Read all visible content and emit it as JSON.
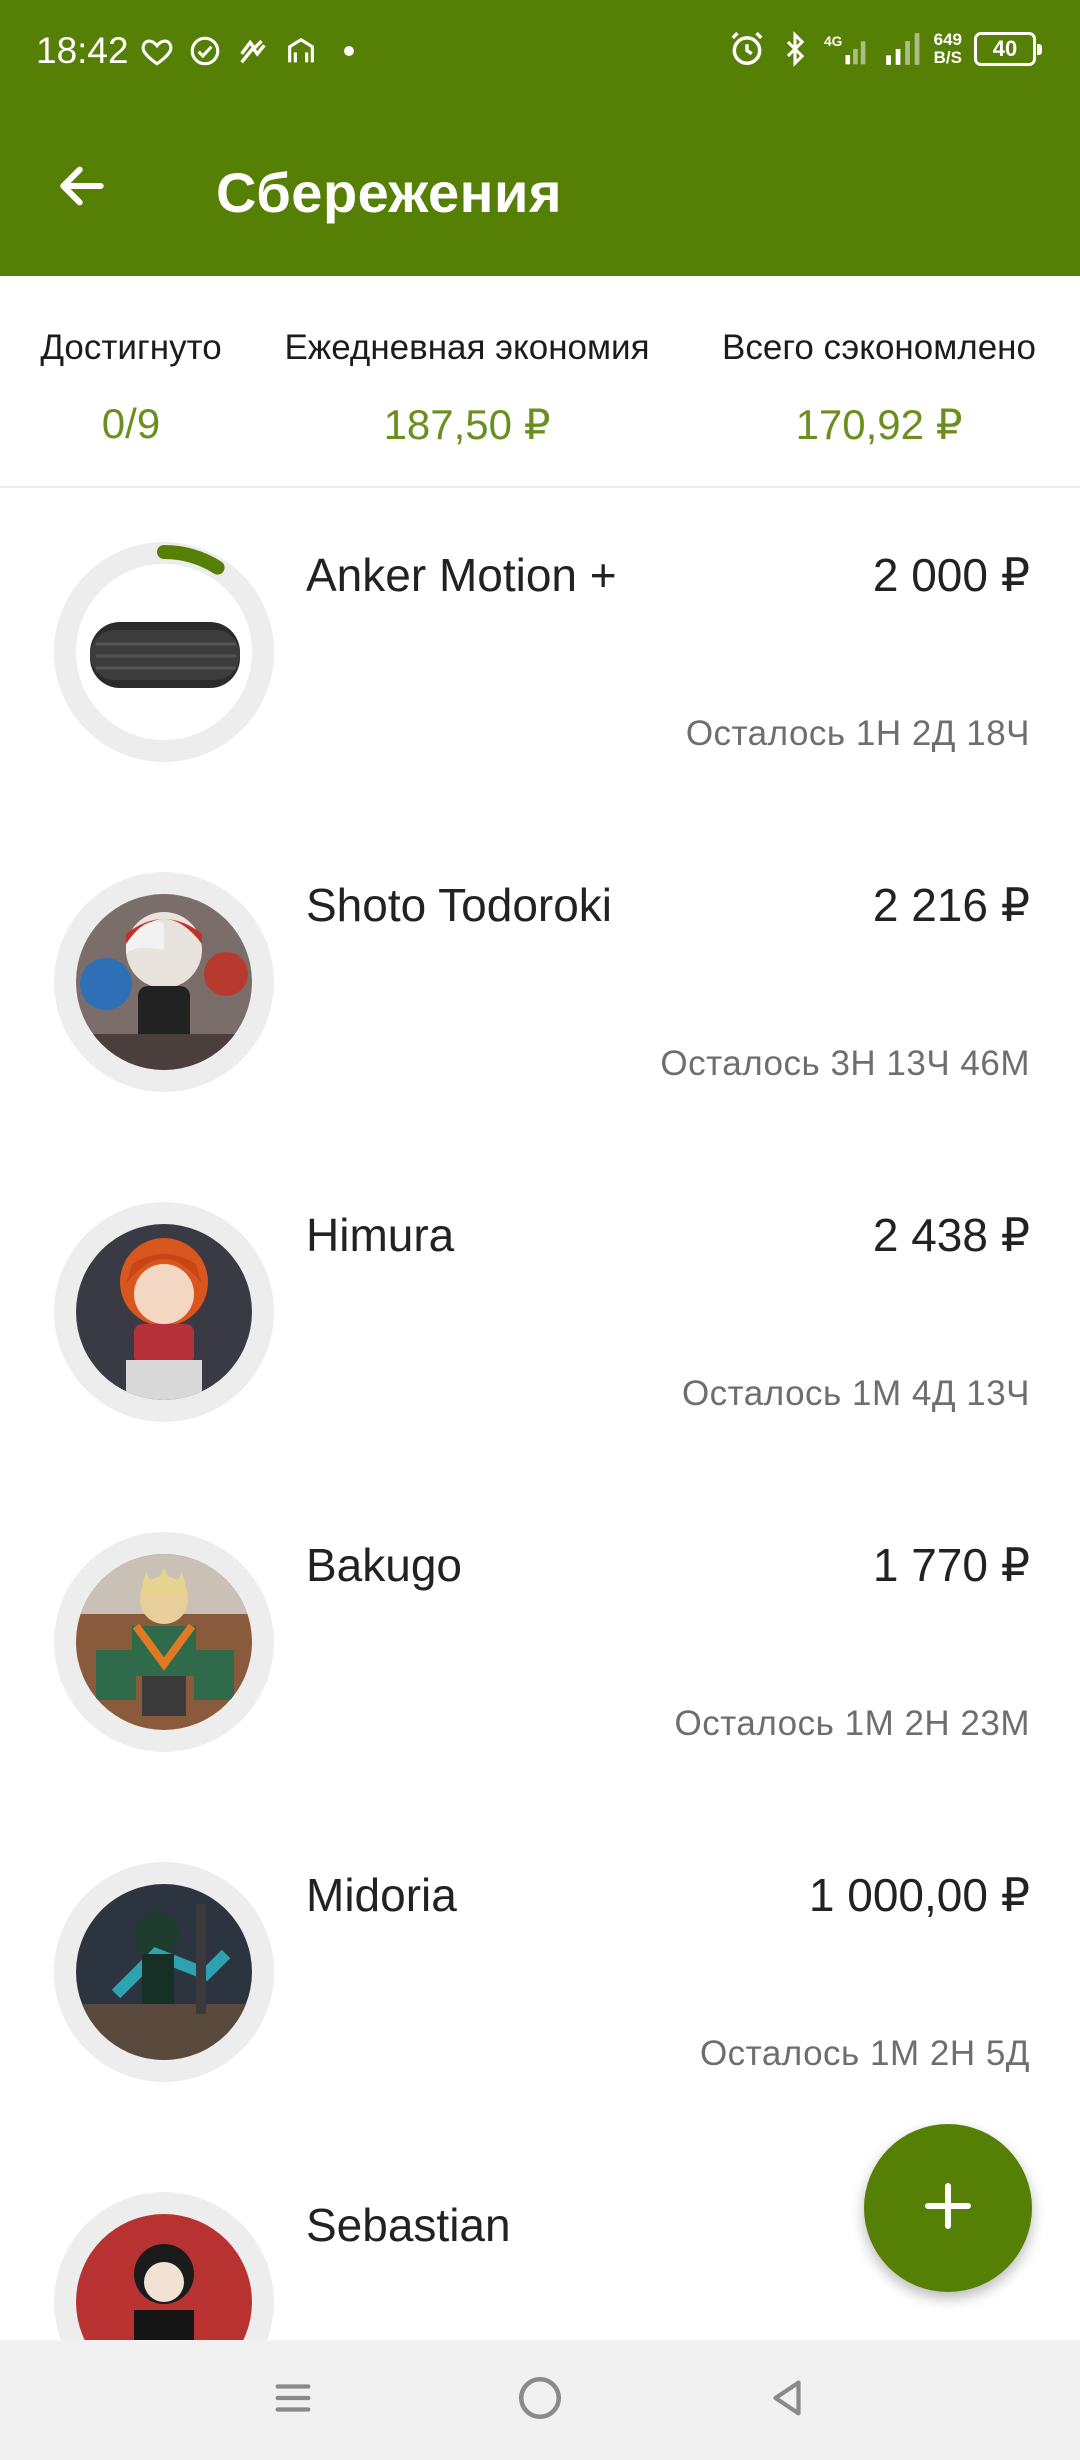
{
  "status_bar": {
    "time": "18:42",
    "net_speed_value": "649",
    "net_speed_unit": "B/S",
    "battery": "40",
    "network": "4G"
  },
  "app_bar": {
    "title": "Сбережения",
    "back_icon": "arrow-back-icon"
  },
  "summary": {
    "achieved_label": "Достигнуто",
    "achieved_value": "0/9",
    "daily_label": "Ежедневная экономия",
    "daily_value": "187,50 ₽",
    "total_label": "Всего сэкономлено",
    "total_value": "170,92 ₽"
  },
  "items": [
    {
      "name": "Anker Motion +",
      "price": "2 000 ₽",
      "left": "Осталось 1Н 2Д 18Ч",
      "progress": 0.09
    },
    {
      "name": "Shoto Todoroki",
      "price": "2 216 ₽",
      "left": "Осталось 3Н 13Ч 46М",
      "progress": 0
    },
    {
      "name": "Himura",
      "price": "2 438 ₽",
      "left": "Осталось 1М 4Д 13Ч",
      "progress": 0
    },
    {
      "name": "Bakugo",
      "price": "1 770 ₽",
      "left": "Осталось 1М 2Н 23М",
      "progress": 0
    },
    {
      "name": "Midoria",
      "price": "1 000,00 ₽",
      "left": "Осталось 1М 2Н 5Д",
      "progress": 0
    },
    {
      "name": "Sebastian",
      "price": "",
      "left": "",
      "progress": 0
    }
  ],
  "fab": {
    "icon": "plus-icon"
  },
  "nav": {
    "menu_icon": "menu-icon",
    "home_icon": "home-circle-icon",
    "back_icon": "back-triangle-icon"
  },
  "colors": {
    "primary": "#567f05",
    "accent_text": "#6a8f1e"
  }
}
